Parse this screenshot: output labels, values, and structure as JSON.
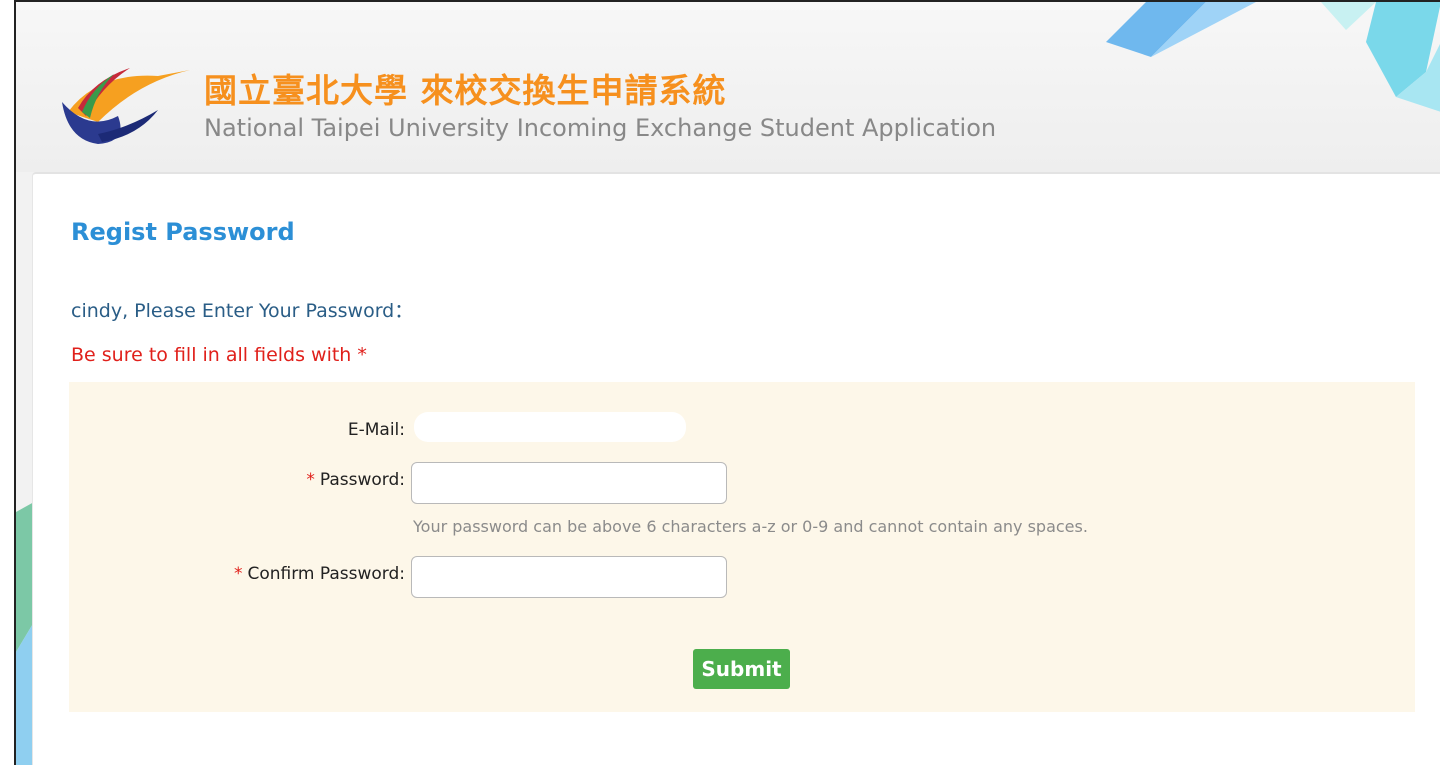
{
  "header": {
    "title_cn": "國立臺北大學 來校交換生申請系統",
    "title_en": "National Taipei University Incoming Exchange Student Application",
    "logo_icon": "ntpu-logo-icon"
  },
  "page": {
    "title": "Regist Password",
    "prompt": "cindy, Please Enter Your Password：",
    "required_note": "Be sure to fill in all fields with *"
  },
  "form": {
    "email": {
      "label": "E-Mail:",
      "value": ""
    },
    "password": {
      "required_mark": "*",
      "label": "Password:",
      "value": "",
      "hint": "Your password can be above 6 characters a-z or 0-9 and cannot contain any spaces."
    },
    "confirm": {
      "required_mark": "*",
      "label": "Confirm Password:",
      "value": ""
    },
    "submit_label": "Submit"
  },
  "colors": {
    "title_orange": "#f6901e",
    "title_blue": "#2c8fd6",
    "required_red": "#e0201b",
    "panel_bg": "#fdf7e9",
    "submit_green": "#4cae4c"
  }
}
